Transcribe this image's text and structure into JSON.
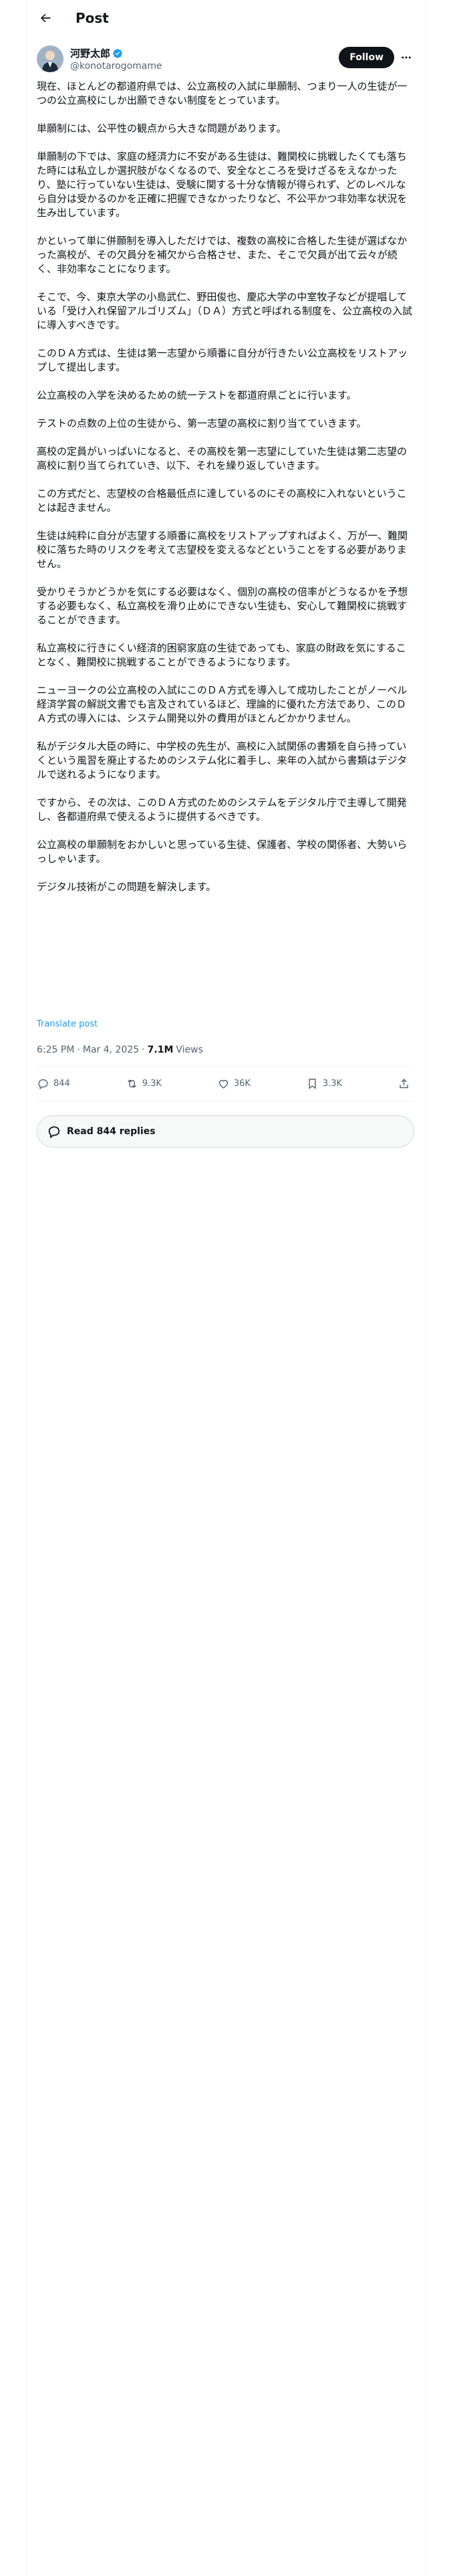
{
  "header": {
    "title": "Post"
  },
  "author": {
    "display_name": "河野太郎",
    "handle": "@konotarogomame",
    "follow_label": "Follow"
  },
  "post": {
    "paragraphs": [
      "現在、ほとんどの都道府県では、公立高校の入試に単願制、つまり一人の生徒が一つの公立高校にしか出願できない制度をとっています。",
      "単願制には、公平性の観点から大きな問題があります。",
      "単願制の下では、家庭の経済力に不安がある生徒は、難関校に挑戦したくても落ちた時には私立しか選択肢がなくなるので、安全なところを受けざるをえなかったり、塾に行っていない生徒は、受験に関する十分な情報が得られず、どのレベルなら自分は受かるのかを正確に把握できなかったりなど、不公平かつ非効率な状況を生み出しています。",
      "かといって単に併願制を導入しただけでは、複数の高校に合格した生徒が選ばなかった高校が、その欠員分を補欠から合格させ、また、そこで欠員が出て云々が続く、非効率なことになります。",
      "そこで、今、東京大学の小島武仁、野田俊也、慶応大学の中室牧子などが提唱している「受け入れ保留アルゴリズム」（ＤＡ）方式と呼ばれる制度を、公立高校の入試に導入すべきです。",
      "このＤＡ方式は、生徒は第一志望から順番に自分が行きたい公立高校をリストアップして提出します。",
      "公立高校の入学を決めるための統一テストを都道府県ごとに行います。",
      "テストの点数の上位の生徒から、第一志望の高校に割り当てていきます。",
      "高校の定員がいっぱいになると、その高校を第一志望にしていた生徒は第二志望の高校に割り当てられていき、以下、それを繰り返していきます。",
      "この方式だと、志望校の合格最低点に達しているのにその高校に入れないということは起きません。",
      "生徒は純粋に自分が志望する順番に高校をリストアップすればよく、万が一、難関校に落ちた時のリスクを考えて志望校を変えるなどということをする必要がありません。",
      "受かりそうかどうかを気にする必要はなく、個別の高校の倍率がどうなるかを予想する必要もなく、私立高校を滑り止めにできない生徒も、安心して難関校に挑戦することができます。",
      "私立高校に行きにくい経済的困窮家庭の生徒であっても、家庭の財政を気にすることなく、難関校に挑戦することができるようになります。",
      "ニューヨークの公立高校の入試にこのＤＡ方式を導入して成功したことがノーベル経済学賞の解説文書でも言及されているほど、理論的に優れた方法であり、このＤＡ方式の導入には、システム開発以外の費用がほとんどかかりません。",
      "私がデジタル大臣の時に、中学校の先生が、高校に入試関係の書類を自ら持っていくという風習を廃止するためのシステム化に着手し、来年の入試から書類はデジタルで送れるようになります。",
      "ですから、その次は、このＤＡ方式のためのシステムをデジタル庁で主導して開発し、各都道府県で使えるように提供するべきです。",
      "公立高校の単願制をおかしいと思っている生徒、保護者、学校の関係者、大勢いらっしゃいます。",
      "デジタル技術がこの問題を解決します。"
    ],
    "translate_label": "Translate post",
    "time": "6:25 PM",
    "date": "Mar 4, 2025",
    "views_count": "7.1M",
    "views_label": "Views"
  },
  "actions": {
    "replies": "844",
    "reposts": "9.3K",
    "likes": "36K",
    "bookmarks": "3.3K"
  },
  "read_replies_label": "Read 844 replies",
  "colors": {
    "accent": "#1d9bf0",
    "text": "#0f1419",
    "muted": "#536471"
  }
}
